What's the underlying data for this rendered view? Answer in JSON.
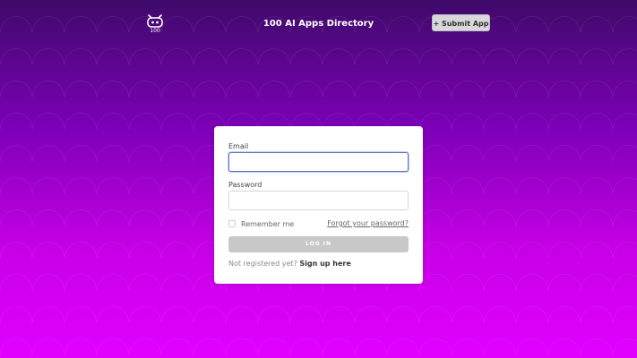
{
  "header": {
    "logo_text": "100",
    "title": "100 AI Apps Directory",
    "submit_label": "+ Submit App"
  },
  "login": {
    "email_label": "Email",
    "email_value": "",
    "password_label": "Password",
    "password_value": "",
    "remember_label": "Remember me",
    "forgot_label": "Forgot your password?",
    "login_label": "LOG IN",
    "not_registered_text": "Not registered yet?",
    "signup_label": "Sign up here"
  },
  "colors": {
    "background_top": "#3f0a69",
    "background_bottom": "#e100ff",
    "focus_border": "#5a74c7",
    "button_gray": "#c8c8c8"
  },
  "icons": {
    "logo": "robot-icon"
  }
}
